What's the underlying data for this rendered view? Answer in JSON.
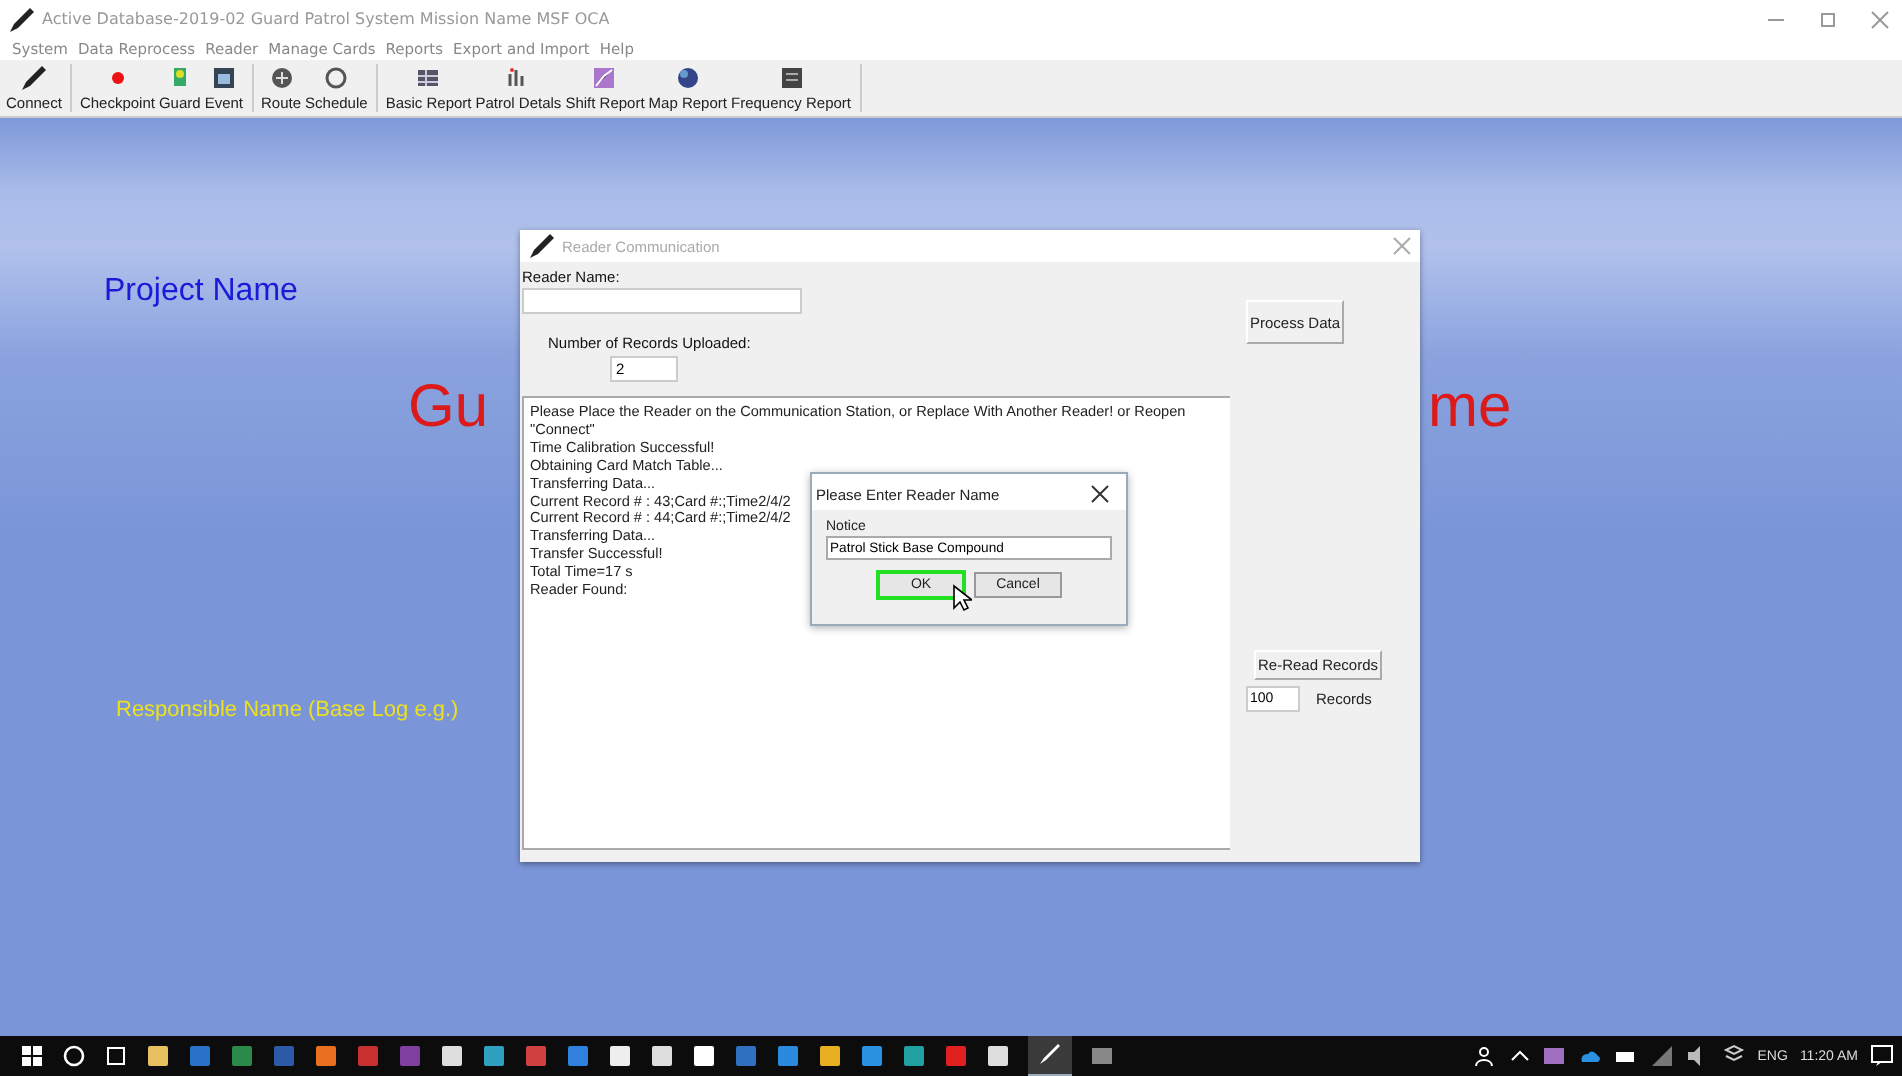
{
  "window": {
    "title": "Active Database-2019-02  Guard Patrol System Mission Name   MSF OCA"
  },
  "menu": [
    "System",
    "Data Reprocess",
    "Reader",
    "Manage Cards",
    "Reports",
    "Export and Import",
    "Help"
  ],
  "toolbar": [
    [
      "Connect"
    ],
    [
      "Checkpoint",
      "Guard",
      "Event"
    ],
    [
      "Route",
      "Schedule"
    ],
    [
      "Basic Report",
      "Patrol Detals",
      "Shift Report",
      "Map Report",
      "Frequency Report"
    ]
  ],
  "background": {
    "project_name": "Project Name",
    "title_left": "Gu",
    "title_right": "me",
    "responsible_name": "Responsible Name (Base Log e.g.)"
  },
  "dialog": {
    "title": "Reader Communication",
    "reader_name_label": "Reader Name:",
    "records_label": "Number of Records Uploaded:",
    "records_value": "2",
    "log": [
      "Please Place the Reader on the Communication Station, or Replace With Another Reader!   or Reopen \"Connect\"",
      "Time Calibration Successful!",
      "Obtaining Card Match Table...",
      "Transferring Data...",
      "Current Record # :  43;Card #:;Time2/4/2",
      "Current Record # :  44;Card #:;Time2/4/2",
      "Transferring Data...",
      "Transfer Successful!",
      "Total Time=17 s",
      "Reader Found:"
    ],
    "process_button": "Process Data",
    "reread_button": "Re-Read Records",
    "reread_count": "100",
    "reread_unit": "Records"
  },
  "prompt": {
    "title": "Please Enter  Reader Name",
    "label": "Notice",
    "value": "Patrol Stick Base Compound",
    "buttons": [
      {
        "label": "OK",
        "selected": true
      },
      {
        "label": "Cancel",
        "selected": false
      }
    ]
  },
  "taskbar": {
    "language": "ENG",
    "time": "11:20 AM"
  }
}
